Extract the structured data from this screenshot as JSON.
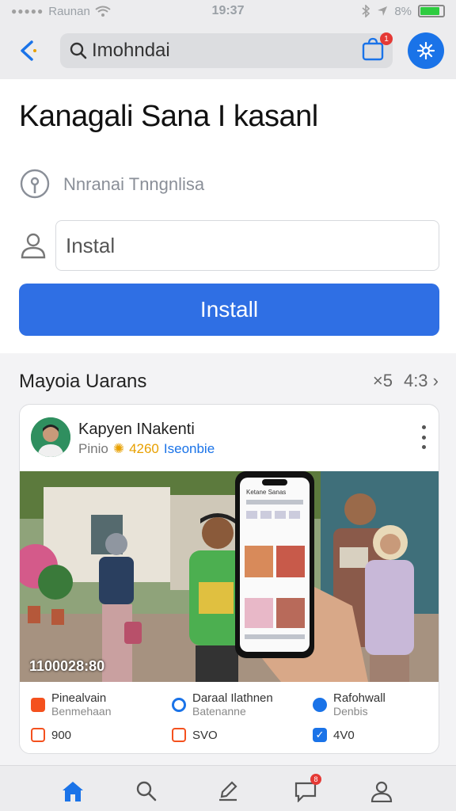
{
  "status_bar": {
    "carrier": "Raunan",
    "time": "19:37",
    "battery_text": "8%",
    "battery_level": 0.85
  },
  "topbar": {
    "search_value": "Imohndai",
    "cart_badge": "1"
  },
  "main": {
    "title": "Kanagali Sana I kasanl",
    "info_text": "Nnranai Tnngnlisa",
    "name_field_value": "Instal",
    "install_button": "Install"
  },
  "section": {
    "title": "Mayoia Uarans",
    "meta_left": "×5",
    "meta_right": "4:3"
  },
  "post": {
    "author": "Kapyen INakenti",
    "meta_prefix": "Pinio",
    "meta_count": "4260",
    "meta_tag": "Iseonbie",
    "photo_caption": "1100028:80",
    "phone_header": "Ketane Sanas",
    "stats": [
      {
        "label": "Pinealvain",
        "sub": "Benmehaan",
        "value": "900",
        "color": "#f4511e"
      },
      {
        "label": "Daraal Ilathnen",
        "sub": "Batenanne",
        "value": "SVO",
        "color": "#1a73e8"
      },
      {
        "label": "Rafohwall",
        "sub": "Denbis",
        "value": "4V0",
        "color": "#1a73e8"
      }
    ]
  },
  "nav": {
    "messages_badge": "8"
  },
  "colors": {
    "accent": "#2f6fe4",
    "badge": "#e53935",
    "background": "#f3f3f5"
  }
}
